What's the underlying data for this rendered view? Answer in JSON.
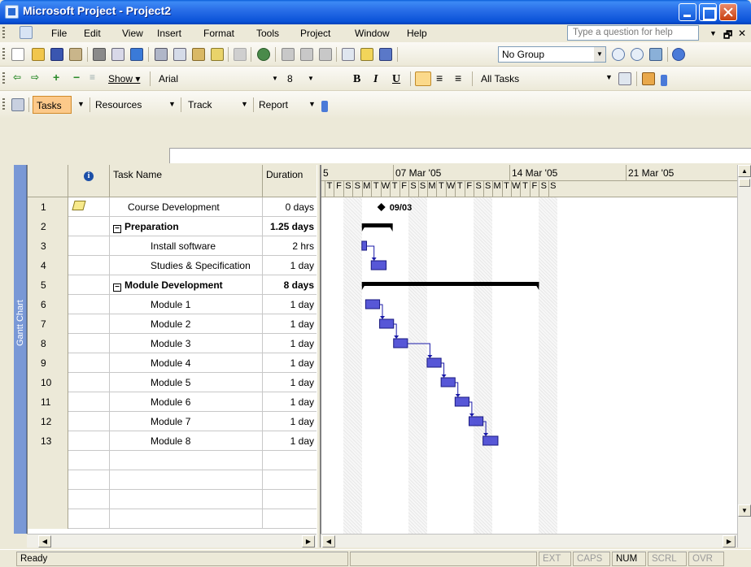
{
  "window": {
    "title": "Microsoft Project - Project2"
  },
  "menu": {
    "items": [
      "File",
      "Edit",
      "View",
      "Insert",
      "Format",
      "Tools",
      "Project",
      "Window",
      "Help"
    ],
    "help_placeholder": "Type a question for help"
  },
  "standard_toolbar": {
    "group_value": "No Group"
  },
  "formatting_toolbar": {
    "show_label": "Show",
    "font": "Arial",
    "font_size": "8",
    "filter_value": "All Tasks"
  },
  "guide_toolbar": {
    "tasks": "Tasks",
    "resources": "Resources",
    "track": "Track",
    "report": "Report"
  },
  "view_bar": {
    "label": "Gantt Chart"
  },
  "table": {
    "headers": {
      "task_name": "Task Name",
      "duration": "Duration"
    },
    "rows": [
      {
        "id": "1",
        "name": "Course Development",
        "duration": "0 days",
        "bold": false,
        "summary": false,
        "has_note": true
      },
      {
        "id": "2",
        "name": "Preparation",
        "duration": "1.25 days",
        "bold": true,
        "summary": true,
        "has_note": false
      },
      {
        "id": "3",
        "name": "Install software",
        "duration": "2 hrs",
        "bold": false,
        "summary": false,
        "has_note": false
      },
      {
        "id": "4",
        "name": "Studies & Specification",
        "duration": "1 day",
        "bold": false,
        "summary": false,
        "has_note": false
      },
      {
        "id": "5",
        "name": "Module Development",
        "duration": "8 days",
        "bold": true,
        "summary": true,
        "has_note": false
      },
      {
        "id": "6",
        "name": "Module 1",
        "duration": "1 day",
        "bold": false,
        "summary": false,
        "has_note": false
      },
      {
        "id": "7",
        "name": "Module 2",
        "duration": "1 day",
        "bold": false,
        "summary": false,
        "has_note": false
      },
      {
        "id": "8",
        "name": "Module 3",
        "duration": "1 day",
        "bold": false,
        "summary": false,
        "has_note": false
      },
      {
        "id": "9",
        "name": "Module 4",
        "duration": "1 day",
        "bold": false,
        "summary": false,
        "has_note": false
      },
      {
        "id": "10",
        "name": "Module 5",
        "duration": "1 day",
        "bold": false,
        "summary": false,
        "has_note": false
      },
      {
        "id": "11",
        "name": "Module 6",
        "duration": "1 day",
        "bold": false,
        "summary": false,
        "has_note": false
      },
      {
        "id": "12",
        "name": "Module 7",
        "duration": "1 day",
        "bold": false,
        "summary": false,
        "has_note": false
      },
      {
        "id": "13",
        "name": "Module 8",
        "duration": "1 day",
        "bold": false,
        "summary": false,
        "has_note": false
      }
    ]
  },
  "gantt": {
    "weeks": [
      "5",
      "07 Mar '05",
      "14 Mar '05",
      "21 Mar '05"
    ],
    "day_letters": [
      "T",
      "F",
      "S",
      "S",
      "M",
      "T",
      "W",
      "T",
      "F",
      "S",
      "S",
      "M",
      "T",
      "W",
      "T",
      "F",
      "S",
      "S",
      "M",
      "T",
      "W",
      "T",
      "F",
      "S",
      "S"
    ],
    "milestone_label": "09/03",
    "bar_color": "#3a3ad0"
  },
  "status": {
    "text": "Ready",
    "ext": "EXT",
    "caps": "CAPS",
    "num": "NUM",
    "scrl": "SCRL",
    "ovr": "OVR"
  }
}
